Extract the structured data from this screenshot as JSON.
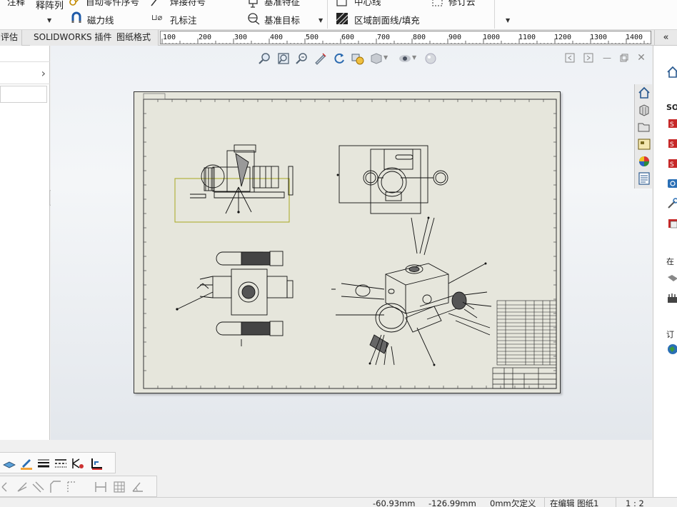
{
  "ribbon": {
    "items": [
      {
        "label": "注释",
        "icon": "note-icon"
      },
      {
        "label": "释阵列",
        "icon": "note-array-icon"
      },
      {
        "label": "自动零件序号",
        "icon": "auto-balloon-icon"
      },
      {
        "label": "焊接符号",
        "icon": "weld-symbol-icon"
      },
      {
        "label": "基准特征",
        "icon": "datum-feature-icon"
      },
      {
        "label": "中心线",
        "icon": "centerline-icon"
      },
      {
        "label": "修订云",
        "icon": "revision-cloud-icon"
      },
      {
        "label": "磁力线",
        "icon": "magnetic-line-icon"
      },
      {
        "label": "孔标注",
        "icon": "hole-callout-icon"
      },
      {
        "label": "基准目标",
        "icon": "datum-target-icon"
      },
      {
        "label": "区域剖面线/填充",
        "icon": "area-hatch-icon"
      }
    ]
  },
  "tabs": [
    {
      "label": "评估"
    },
    {
      "label": "SOLIDWORKS 插件"
    },
    {
      "label": "图纸格式"
    }
  ],
  "ruler": {
    "ticks": [
      "100",
      "200",
      "300",
      "400",
      "500",
      "600",
      "700",
      "800",
      "900",
      "1000",
      "1100",
      "1200",
      "1300",
      "1400"
    ]
  },
  "heads_up_toolbar": {
    "icons": [
      "zoom-to-fit-icon",
      "zoom-area-icon",
      "zoom-in-out-icon",
      "pan-icon",
      "rotate-icon",
      "redraw-icon",
      "display-style-icon",
      "hide-show-icon",
      "appearance-icon",
      "scene-icon"
    ]
  },
  "window_controls": [
    "tile-left-icon",
    "tile-right-icon",
    "minimize-icon",
    "restore-icon",
    "close-icon"
  ],
  "taskpane_tabs": [
    "home-icon",
    "design-library-icon",
    "file-explorer-icon",
    "view-palette-icon",
    "appearances-icon",
    "custom-properties-icon"
  ],
  "right_pane": {
    "sections": [
      {
        "label": "SO"
      },
      {
        "label": "在"
      },
      {
        "label": "订"
      }
    ]
  },
  "bottom_toolbar": {
    "row1_icons": [
      "layer-icon",
      "line-color-icon",
      "line-thickness-icon",
      "line-style-icon",
      "hide-show-edges-icon",
      "color-display-mode-icon"
    ],
    "row2_icons": [
      "smart-dimension-icon",
      "angle-icon",
      "parallel-icon",
      "chamfer-icon",
      "ordinate-icon",
      "baseline-dim-icon",
      "table-icon",
      "angle-dim-icon"
    ]
  },
  "status": {
    "x": "-60.93mm",
    "y": "-126.99mm",
    "z": "0mm",
    "definition": "欠定义",
    "mode": "在编辑 图纸1",
    "scale": "1 : 2"
  },
  "colors": {
    "sheet": "#e6e6dc",
    "selected_view_box": "#a8a820",
    "graphics_bg": "#eef1f5"
  }
}
